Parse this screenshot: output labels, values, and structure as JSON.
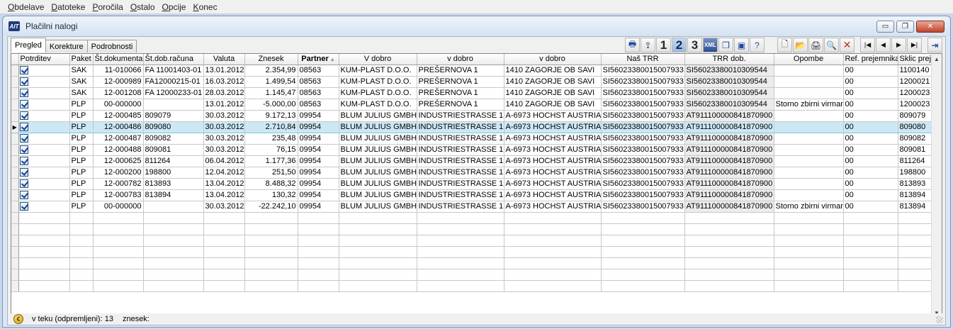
{
  "menu": [
    {
      "accel": "O",
      "rest": "bdelave"
    },
    {
      "accel": "D",
      "rest": "atoteke"
    },
    {
      "accel": "P",
      "rest": "oročila"
    },
    {
      "accel": "O",
      "rest": "stalo"
    },
    {
      "accel": "O",
      "rest": "pcije"
    },
    {
      "accel": "K",
      "rest": "onec"
    }
  ],
  "window": {
    "title": "Plačilni nalogi",
    "app_icon_text": "AIT",
    "minimize": "▭",
    "restore": "❐",
    "close": "✕"
  },
  "tabs": [
    "Pregled",
    "Korekture",
    "Podrobnosti"
  ],
  "toolbar1": [
    {
      "name": "print-icon",
      "glyph": "🖶",
      "cls": "blue"
    },
    {
      "name": "export-icon",
      "glyph": "⇪",
      "cls": ""
    },
    {
      "name": "level-1-button",
      "glyph": "1",
      "cls": "num"
    },
    {
      "name": "level-2-button",
      "glyph": "2",
      "cls": "num filled"
    },
    {
      "name": "level-3-button",
      "glyph": "3",
      "cls": "num"
    },
    {
      "name": "xml-icon",
      "glyph": "XML",
      "cls": "navy"
    },
    {
      "name": "copy-window-icon",
      "glyph": "❐",
      "cls": "blue"
    },
    {
      "name": "screen-icon",
      "glyph": "▣",
      "cls": "blue"
    },
    {
      "name": "help-icon",
      "glyph": "?",
      "cls": "blue"
    }
  ],
  "toolbar2": [
    {
      "name": "new-document-icon",
      "glyph": "🗋",
      "cls": ""
    },
    {
      "name": "open-folder-icon",
      "glyph": "📂",
      "cls": ""
    },
    {
      "name": "printer-icon",
      "glyph": "🖨",
      "cls": ""
    },
    {
      "name": "search-icon",
      "glyph": "🔍",
      "cls": "blue"
    },
    {
      "name": "delete-icon",
      "glyph": "✕",
      "cls": "red"
    }
  ],
  "toolbar3": [
    {
      "name": "first-record-icon",
      "glyph": "|◀",
      "cls": "nav"
    },
    {
      "name": "previous-record-icon",
      "glyph": "◀",
      "cls": "nav"
    },
    {
      "name": "next-record-icon",
      "glyph": "▶",
      "cls": "nav"
    },
    {
      "name": "last-record-icon",
      "glyph": "▶|",
      "cls": "nav"
    }
  ],
  "exit_icon": "⇥",
  "columns": [
    "Potrditev",
    "Paket",
    "Št.dokumenta",
    "Št.dob.računa",
    "Valuta",
    "Znesek",
    "Partner",
    "V dobro",
    "v dobro",
    "v dobro",
    "Naš TRR",
    "TRR dob.",
    "Opombe",
    "Ref. prejemnika",
    "Sklic prej"
  ],
  "sort_arrow": "▲",
  "rows": [
    [
      "SAK",
      "11-010066",
      "FA 11001403-01",
      "13.01.2012",
      "2.354,99",
      "08563",
      "KUM-PLAST D.O.O.",
      "PREŠERNOVA 1",
      "1410 ZAGORJE OB SAVI",
      "SI56023380015007933",
      "SI56023380010309544",
      "",
      "00",
      "1100140"
    ],
    [
      "SAK",
      "12-000989",
      "FA12000215-01",
      "16.03.2012",
      "1.499,54",
      "08563",
      "KUM-PLAST D.O.O.",
      "PREŠERNOVA 1",
      "1410 ZAGORJE OB SAVI",
      "SI56023380015007933",
      "SI56023380010309544",
      "",
      "00",
      "1200021"
    ],
    [
      "SAK",
      "12-001208",
      "FA 12000233-01",
      "28.03.2012",
      "1.145,47",
      "08563",
      "KUM-PLAST D.O.O.",
      "PREŠERNOVA 1",
      "1410 ZAGORJE OB SAVI",
      "SI56023380015007933",
      "SI56023380010309544",
      "",
      "00",
      "1200023"
    ],
    [
      "PLP",
      "00-000000",
      "",
      "13.01.2012",
      "-5.000,00",
      "08563",
      "KUM-PLAST D.O.O.",
      "PREŠERNOVA 1",
      "1410 ZAGORJE OB SAVI",
      "SI56023380015007933",
      "SI56023380010309544",
      "Storno zbirni virman",
      "00",
      "1200023"
    ],
    [
      "PLP",
      "12-000485",
      "809079",
      "30.03.2012",
      "9.172,13",
      "09954",
      "BLUM JULIUS GMBH",
      "INDUSTRIESTRASSE 1",
      "A-6973 HOCHST AUSTRIA",
      "SI56023380015007933",
      "AT911100000841870900",
      "",
      "00",
      "809079"
    ],
    [
      "PLP",
      "12-000486",
      "809080",
      "30.03.2012",
      "2.710,84",
      "09954",
      "BLUM JULIUS GMBH",
      "INDUSTRIESTRASSE 1",
      "A-6973 HOCHST AUSTRIA",
      "SI56023380015007933",
      "AT911100000841870900",
      "",
      "00",
      "809080"
    ],
    [
      "PLP",
      "12-000487",
      "809082",
      "30.03.2012",
      "235,48",
      "09954",
      "BLUM JULIUS GMBH",
      "INDUSTRIESTRASSE 1",
      "A-6973 HOCHST AUSTRIA",
      "SI56023380015007933",
      "AT911100000841870900",
      "",
      "00",
      "809082"
    ],
    [
      "PLP",
      "12-000488",
      "809081",
      "30.03.2012",
      "76,15",
      "09954",
      "BLUM JULIUS GMBH",
      "INDUSTRIESTRASSE 1",
      "A-6973 HOCHST AUSTRIA",
      "SI56023380015007933",
      "AT911100000841870900",
      "",
      "00",
      "809081"
    ],
    [
      "PLP",
      "12-000625",
      "811264",
      "06.04.2012",
      "1.177,36",
      "09954",
      "BLUM JULIUS GMBH",
      "INDUSTRIESTRASSE 1",
      "A-6973 HOCHST AUSTRIA",
      "SI56023380015007933",
      "AT911100000841870900",
      "",
      "00",
      "811264"
    ],
    [
      "PLP",
      "12-000200",
      "198800",
      "12.04.2012",
      "251,50",
      "09954",
      "BLUM JULIUS GMBH",
      "INDUSTRIESTRASSE 1",
      "A-6973 HOCHST AUSTRIA",
      "SI56023380015007933",
      "AT911100000841870900",
      "",
      "00",
      "198800"
    ],
    [
      "PLP",
      "12-000782",
      "813893",
      "13.04.2012",
      "8.488,32",
      "09954",
      "BLUM JULIUS GMBH",
      "INDUSTRIESTRASSE 1",
      "A-6973 HOCHST AUSTRIA",
      "SI56023380015007933",
      "AT911100000841870900",
      "",
      "00",
      "813893"
    ],
    [
      "PLP",
      "12-000783",
      "813894",
      "13.04.2012",
      "130,32",
      "09954",
      "BLUM JULIUS GMBH",
      "INDUSTRIESTRASSE 1",
      "A-6973 HOCHST AUSTRIA",
      "SI56023380015007933",
      "AT911100000841870900",
      "",
      "00",
      "813894"
    ],
    [
      "PLP",
      "00-000000",
      "",
      "30.03.2012",
      "-22.242,10",
      "09954",
      "BLUM JULIUS GMBH",
      "INDUSTRIESTRASSE 1",
      "A-6973 HOCHST AUSTRIA",
      "SI56023380015007933",
      "AT911100000841870900",
      "Storno zbirni virman",
      "00",
      "813894"
    ]
  ],
  "selected_row": 5,
  "row_indicator": "▶",
  "empty_rows": 7,
  "scroll_up": "▲",
  "scroll_down": "▼",
  "status": {
    "icon": "€",
    "count_text": "v teku (odpremljeni): 13",
    "amount_label": "znesek:"
  }
}
